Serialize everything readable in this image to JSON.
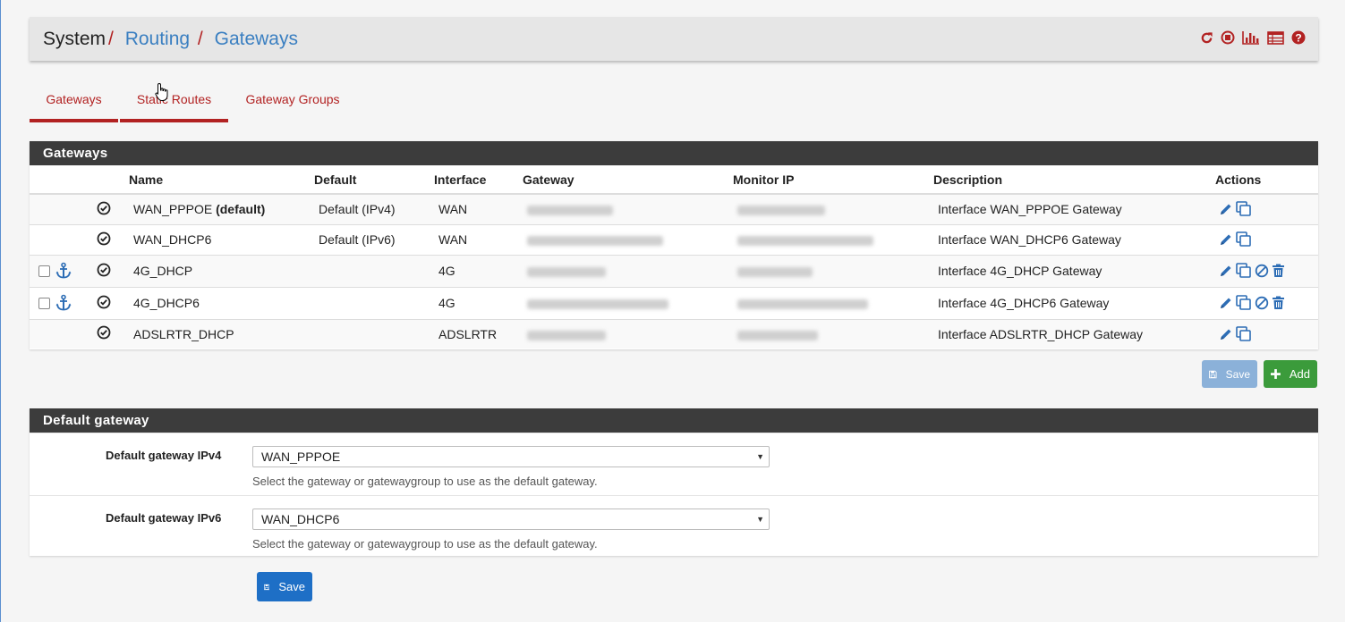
{
  "header": {
    "crumbs": [
      "System",
      "Routing",
      "Gateways"
    ],
    "icons": [
      "reload-icon",
      "stop-icon",
      "chart-icon",
      "table-icon",
      "help-icon"
    ]
  },
  "tabs": [
    {
      "label": "Gateways",
      "active": true
    },
    {
      "label": "Static Routes",
      "active": false
    },
    {
      "label": "Gateway Groups",
      "active": false
    }
  ],
  "gateways_panel": {
    "title": "Gateways",
    "columns": [
      "Name",
      "Default",
      "Interface",
      "Gateway",
      "Monitor IP",
      "Description",
      "Actions"
    ],
    "rows": [
      {
        "name": "WAN_PPPOE",
        "name_suffix": "(default)",
        "default": "Default (IPv4)",
        "interface": "WAN",
        "gateway": "",
        "monitor": "",
        "description": "Interface WAN_PPPOE Gateway",
        "editable_extra": false
      },
      {
        "name": "WAN_DHCP6",
        "name_suffix": "",
        "default": "Default (IPv6)",
        "interface": "WAN",
        "gateway": "",
        "monitor": "",
        "description": "Interface WAN_DHCP6 Gateway",
        "editable_extra": false
      },
      {
        "name": "4G_DHCP",
        "name_suffix": "",
        "default": "",
        "interface": "4G",
        "gateway": "",
        "monitor": "",
        "description": "Interface 4G_DHCP Gateway",
        "editable_extra": true
      },
      {
        "name": "4G_DHCP6",
        "name_suffix": "",
        "default": "",
        "interface": "4G",
        "gateway": "",
        "monitor": "",
        "description": "Interface 4G_DHCP6 Gateway",
        "editable_extra": true
      },
      {
        "name": "ADSLRTR_DHCP",
        "name_suffix": "",
        "default": "",
        "interface": "ADSLRTR",
        "gateway": "",
        "monitor": "",
        "description": "Interface ADSLRTR_DHCP Gateway",
        "editable_extra": false
      }
    ],
    "save_label": "Save",
    "add_label": "Add"
  },
  "default_panel": {
    "title": "Default gateway",
    "ipv4": {
      "label": "Default gateway IPv4",
      "value": "WAN_PPPOE",
      "help": "Select the gateway or gatewaygroup to use as the default gateway."
    },
    "ipv6": {
      "label": "Default gateway IPv6",
      "value": "WAN_DHCP6",
      "help": "Select the gateway or gatewaygroup to use as the default gateway."
    },
    "save_label": "Save"
  },
  "colors": {
    "accent": "#b22222",
    "link": "#3a7fc1",
    "panel_heading": "#3c3c3c",
    "add": "#3b9b3b",
    "save": "#1e6fc6"
  }
}
